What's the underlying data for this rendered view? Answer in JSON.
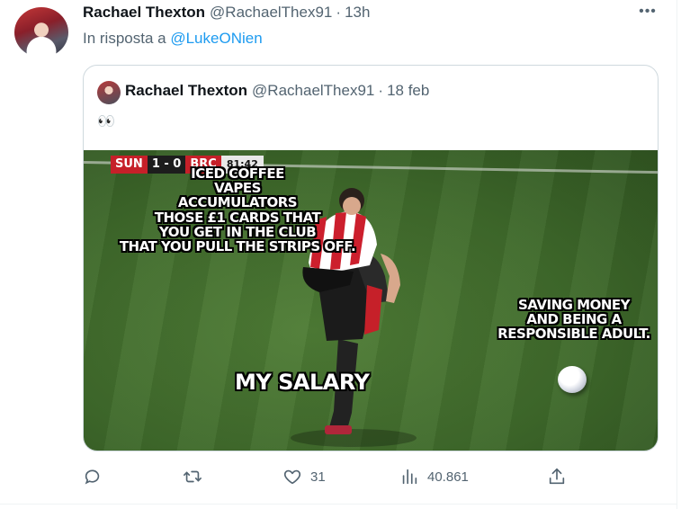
{
  "tweet": {
    "author_name": "Rachael Thexton",
    "author_handle": "@RachaelThex91",
    "dot": "·",
    "time": "13h",
    "more_label": "•••",
    "reply_prefix": "In risposta a",
    "reply_to": "@LukeONien"
  },
  "quoted_tweet": {
    "author_name": "Rachael Thexton",
    "author_handle": "@RachaelThex91",
    "dot": "·",
    "date": "18 feb",
    "text": "👀",
    "image": {
      "scoreboard": {
        "team_home": "SUN",
        "score": "1 - 0",
        "team_away": "BRC",
        "clock": "81:42"
      },
      "meme_list": [
        "ICED COFFEE",
        "VAPES",
        "ACCUMULATORS",
        "THOSE £1 CARDS THAT",
        "YOU GET IN THE CLUB",
        "THAT YOU PULL THE STRIPS OFF."
      ],
      "meme_saving": [
        "SAVING MONEY",
        "AND BEING A",
        "RESPONSIBLE ADULT."
      ],
      "meme_salary": "MY SALARY"
    }
  },
  "actions": {
    "reply_count": "",
    "retweet_count": "",
    "like_count": "31",
    "views_count": "40.861"
  },
  "icons": [
    "reply-icon",
    "retweet-icon",
    "like-icon",
    "views-icon",
    "share-icon",
    "more-icon"
  ],
  "colors": {
    "link": "#1d9bf0",
    "secondary_text": "#536471",
    "border": "#cfd9de"
  }
}
